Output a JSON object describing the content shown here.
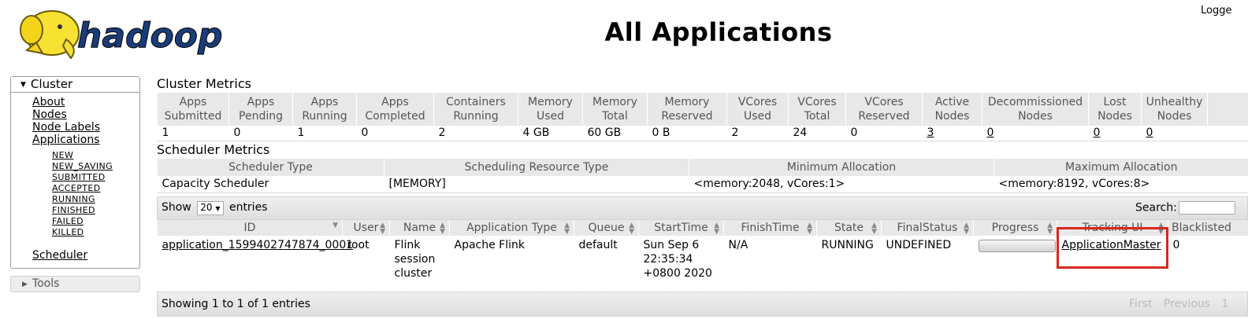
{
  "header": {
    "logo_text": "hadoop",
    "title": "All Applications",
    "logged_in": "Logge"
  },
  "nav": {
    "cluster_label": "Cluster",
    "links": [
      "About",
      "Nodes",
      "Node Labels",
      "Applications"
    ],
    "app_states": [
      "NEW",
      "NEW_SAVING",
      "SUBMITTED",
      "ACCEPTED",
      "RUNNING",
      "FINISHED",
      "FAILED",
      "KILLED"
    ],
    "scheduler_label": "Scheduler",
    "tools_label": "Tools"
  },
  "cluster_metrics": {
    "title": "Cluster Metrics",
    "headers": [
      "Apps Submitted",
      "Apps Pending",
      "Apps Running",
      "Apps Completed",
      "Containers Running",
      "Memory Used",
      "Memory Total",
      "Memory Reserved",
      "VCores Used",
      "VCores Total",
      "VCores Reserved",
      "Active Nodes",
      "Decommissioned Nodes",
      "Lost Nodes",
      "Unhealthy Nodes"
    ],
    "values": [
      "1",
      "0",
      "1",
      "0",
      "2",
      "4 GB",
      "60 GB",
      "0 B",
      "2",
      "24",
      "0",
      "3",
      "0",
      "0",
      "0"
    ]
  },
  "scheduler_metrics": {
    "title": "Scheduler Metrics",
    "headers": [
      "Scheduler Type",
      "Scheduling Resource Type",
      "Minimum Allocation",
      "Maximum Allocation"
    ],
    "values": [
      "Capacity Scheduler",
      "[MEMORY]",
      "<memory:2048, vCores:1>",
      "<memory:8192, vCores:8>"
    ]
  },
  "table_controls": {
    "show_label": "Show",
    "page_size": "20",
    "entries_label": "entries",
    "search_label": "Search:",
    "info": "Showing 1 to 1 of 1 entries",
    "first": "First",
    "previous": "Previous",
    "page": "1"
  },
  "apps_table": {
    "headers": [
      "ID",
      "User",
      "Name",
      "Application Type",
      "Queue",
      "StartTime",
      "FinishTime",
      "State",
      "FinalStatus",
      "Progress",
      "Tracking UI",
      "Blacklisted"
    ],
    "rows": [
      {
        "id": "application_1599402747874_0001",
        "user": "root",
        "name": "Flink session cluster",
        "type": "Apache Flink",
        "queue": "default",
        "start": "Sun Sep 6 22:35:34 +0800 2020",
        "finish": "N/A",
        "state": "RUNNING",
        "final_status": "UNDEFINED",
        "progress": 0,
        "tracking": "ApplicationMaster",
        "blacklisted": "0"
      }
    ]
  },
  "colors": {
    "highlight": "#d9261c",
    "header_bg": "#e8e8e8"
  }
}
